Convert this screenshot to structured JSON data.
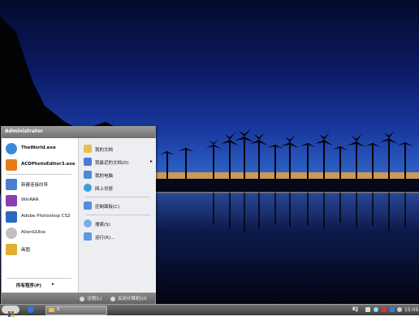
{
  "start_menu": {
    "user": "Administrator",
    "left_items": [
      {
        "label": "TheWorld.exe",
        "icon": "globe-icon",
        "color": "#3b8ad8"
      },
      {
        "label": "ACDPhotoEditor3.exe",
        "icon": "pencil-icon",
        "color": "#e87a1a"
      },
      {
        "label": "新建连接向导",
        "icon": "network-wizard-icon",
        "color": "#4a7fd0"
      },
      {
        "label": "WinRAR",
        "icon": "winrar-icon",
        "color": "#8a3fb0"
      },
      {
        "label": "Adobe Photoshop CS2",
        "icon": "feather-icon",
        "color": "#2a6ac0"
      },
      {
        "label": "AlienGUIse",
        "icon": "alien-icon",
        "color": "#c0c0c0"
      },
      {
        "label": "画图",
        "icon": "paint-icon",
        "color": "#e0b030"
      }
    ],
    "all_programs": "所有程序(P)",
    "right_items": [
      {
        "label": "我的文档",
        "icon": "documents-folder-icon",
        "color": "#e3c050"
      },
      {
        "label": "我最近的文档(D)",
        "icon": "recent-documents-icon",
        "color": "#4b7bd0",
        "has_arrow": true
      },
      {
        "label": "我的电脑",
        "icon": "computer-icon",
        "color": "#4a8ad8"
      },
      {
        "label": "网上邻居",
        "icon": "network-icon",
        "color": "#3aa0d8"
      },
      {
        "label": "控制面板(C)",
        "icon": "control-panel-icon",
        "color": "#5a8ae0"
      },
      {
        "label": "搜索(S)",
        "icon": "search-icon",
        "color": "#7ab0e0"
      },
      {
        "label": "运行(R)...",
        "icon": "run-icon",
        "color": "#5a9ae0"
      }
    ],
    "footer": {
      "logoff": "注销(L)",
      "shutdown": "关闭计算机(U)"
    }
  },
  "taskbar": {
    "window_label": "5",
    "tray_lang": "KJ",
    "clock": "15:05"
  }
}
